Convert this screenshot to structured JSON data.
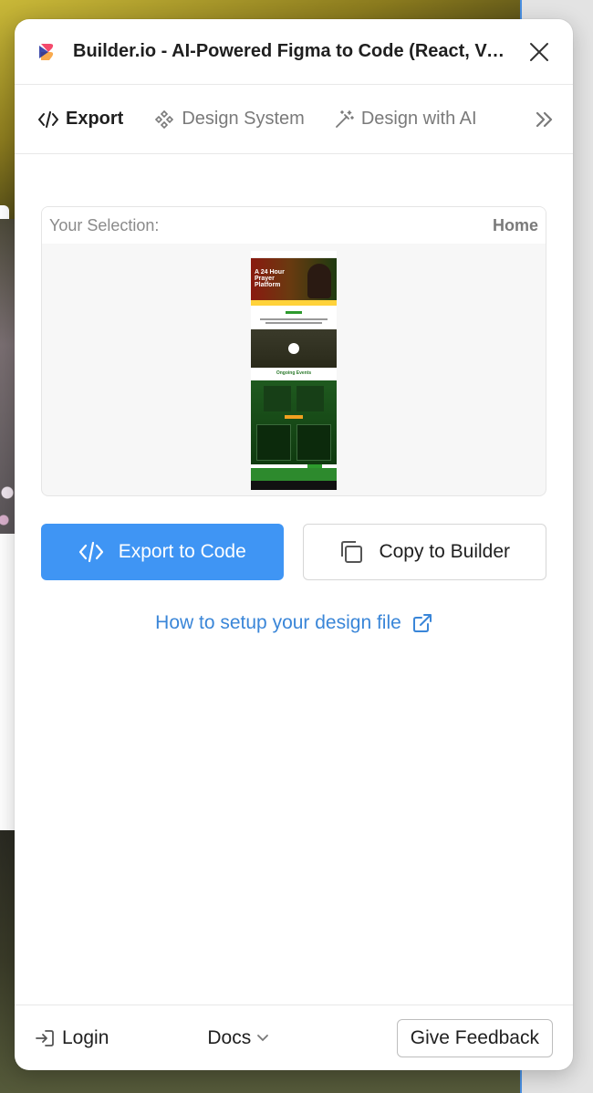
{
  "window": {
    "title": "Builder.io - AI-Powered Figma to Code (React, Vue, Tailwind, & more)",
    "close_icon": "close-icon",
    "logo_colors": [
      "#1c2c9c",
      "#f44a6c",
      "#f8a13a"
    ]
  },
  "tabs": [
    {
      "label": "Export",
      "icon": "code-icon",
      "active": true
    },
    {
      "label": "Design System",
      "icon": "components-icon",
      "active": false
    },
    {
      "label": "Design with AI",
      "icon": "magic-wand-icon",
      "active": false
    }
  ],
  "tabs_more_icon": "chevrons-right-icon",
  "selection": {
    "label": "Your Selection:",
    "frame_name": "Home",
    "preview_texts": {
      "hero": "A 24 Hour Prayer Platform",
      "section2": "Ongoing Events"
    }
  },
  "actions": {
    "export_label": "Export to Code",
    "copy_label": "Copy to Builder"
  },
  "help": {
    "label": "How to setup your design file"
  },
  "footer": {
    "login_label": "Login",
    "docs_label": "Docs",
    "feedback_label": "Give Feedback"
  },
  "colors": {
    "primary": "#3f95f4",
    "link": "#3a86d8"
  }
}
